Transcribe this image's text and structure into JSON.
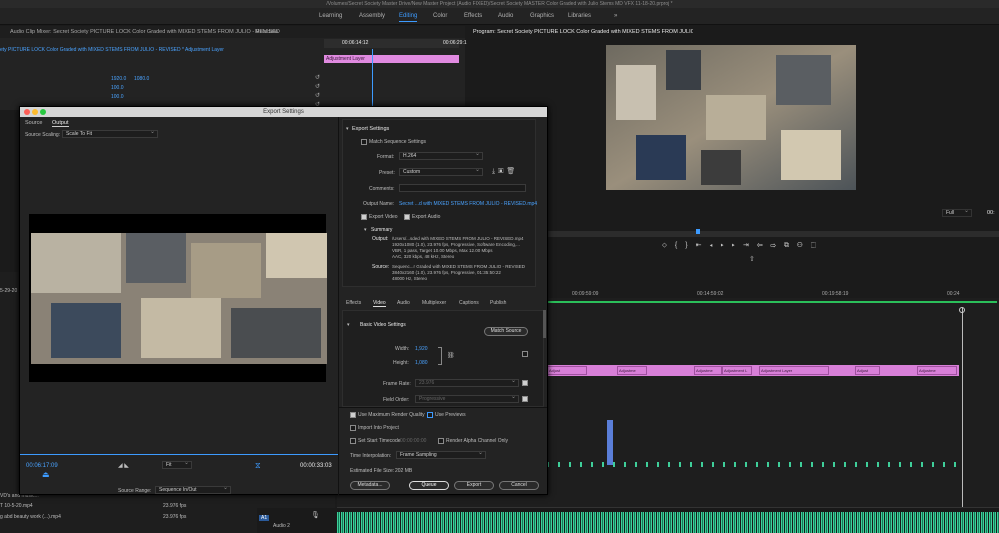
{
  "window": {
    "title": "/Volumes/Secret Society Master Drive/New Master Project (Audio FIXED)/Secret Society MASTER Color Graded with Julio Stems MD VFX 11-18-20.prproj *"
  },
  "workspaces": [
    "Learning",
    "Assembly",
    "Editing",
    "Color",
    "Effects",
    "Audio",
    "Graphics",
    "Libraries",
    "»"
  ],
  "workspace_active": "Editing",
  "top_left_panel": {
    "tabs": [
      "Audio Clip Mixer: Secret Society PICTURE LOCK Color Graded with MIXED STEMS FROM JULIO - REVISED",
      "Metadata"
    ],
    "breadcrumb": "ety PICTURE LOCK Color Graded with MIXED STEMS FROM JULIO - REVISED * Adjustment Layer",
    "values": [
      "1920.0",
      "1080.0",
      "100.0",
      "100.0"
    ],
    "timecodes": [
      "00:06:14:12",
      "00:06:29:1"
    ],
    "adjustment_clip": "Adjustment Layer"
  },
  "program_monitor": {
    "title": "Program: Secret Society PICTURE LOCK Color Graded with MIXED STEMS FROM JULIO - REVISED",
    "fit": "Full",
    "timecode": "00:"
  },
  "export_dialog": {
    "title": "Export Settings",
    "tabs": [
      "Source",
      "Output"
    ],
    "source_scaling_label": "Source Scaling:",
    "source_scaling_value": "Scale To Fit",
    "timecode_in": "00:06:17:09",
    "fit": "Fit",
    "timecode_duration": "00:00:33:03",
    "source_range_label": "Source Range:",
    "source_range_value": "Sequence In/Out",
    "export_settings_header": "Export Settings",
    "match_sequence": "Match Sequence Settings",
    "format_label": "Format:",
    "format_value": "H.264",
    "preset_label": "Preset:",
    "preset_value": "Custom",
    "comments_label": "Comments:",
    "output_name_label": "Output Name:",
    "output_name_value": "Secret ...d with MIXED STEMS FROM JULIO - REVISED.mp4",
    "export_video": "Export Video",
    "export_audio": "Export Audio",
    "summary_header": "Summary",
    "summary_output_label": "Output:",
    "summary_output": [
      "/Users/...sded with MIXED STEMS FROM JULIO - REVISED.mp4",
      "1920x1080 (1.0), 23.976 fps, Progressive, Software Encoding,...",
      "VBR, 1 pass, Target 10.00 Mbps, Max 12.00 Mbps",
      "AAC, 320 kbps, 48 kHz, Stereo"
    ],
    "summary_source_label": "Source:",
    "summary_source": [
      "Sequenc...r Graded with MIXED STEMS FROM JULIO - REVISED",
      "3840x2160 (1.0), 23.976 fps, Progressive, 01:35:50:22",
      "48000 Hz, Stereo"
    ],
    "settings_tabs": [
      "Effects",
      "Video",
      "Audio",
      "Multiplexer",
      "Captions",
      "Publish"
    ],
    "settings_tab_active": "Video",
    "basic_video_header": "Basic Video Settings",
    "match_source": "Match Source",
    "width_label": "Width:",
    "width_value": "1,920",
    "height_label": "Height:",
    "height_value": "1,080",
    "frame_rate_label": "Frame Rate:",
    "frame_rate_value": "23.976",
    "field_order_label": "Field Order:",
    "field_order_value": "Progressive",
    "max_render": "Use Maximum Render Quality",
    "use_previews": "Use Previews",
    "import_project": "Import Into Project",
    "start_timecode": "Set Start Timecode",
    "start_timecode_value": "00:00:00:00",
    "render_alpha": "Render Alpha Channel Only",
    "time_interp_label": "Time Interpolation:",
    "time_interp_value": "Frame Sampling",
    "file_size_label": "Estimated File Size:",
    "file_size_value": "202 MB",
    "buttons": {
      "metadata": "Metadata...",
      "queue": "Queue",
      "export": "Export",
      "cancel": "Cancel"
    }
  },
  "timeline": {
    "ruler": [
      "00:09:59:09",
      "00:14:59:02",
      "00:19:58:19",
      "00:24"
    ],
    "clip_labels": [
      "Adjust",
      "Adjustme",
      "Adjustme",
      "Adjustment L",
      "Adjustment Layer",
      "Adjust",
      "Adjustme"
    ],
    "track_a1": "A1",
    "track_a2": "Audio 2"
  },
  "project_panel": {
    "items": [
      {
        "name": "VD's and music...",
        "fps": ""
      },
      {
        "name": "T 10-5-20.mp4",
        "fps": "23.976 fps"
      },
      {
        "name": "g abd beauty work (...).mp4",
        "fps": "23.976 fps"
      }
    ],
    "timecode": "5-29-20"
  },
  "colors": {
    "accent": "#3d9bff",
    "clip": "#d87fd8",
    "audio": "#3fcf9a"
  }
}
